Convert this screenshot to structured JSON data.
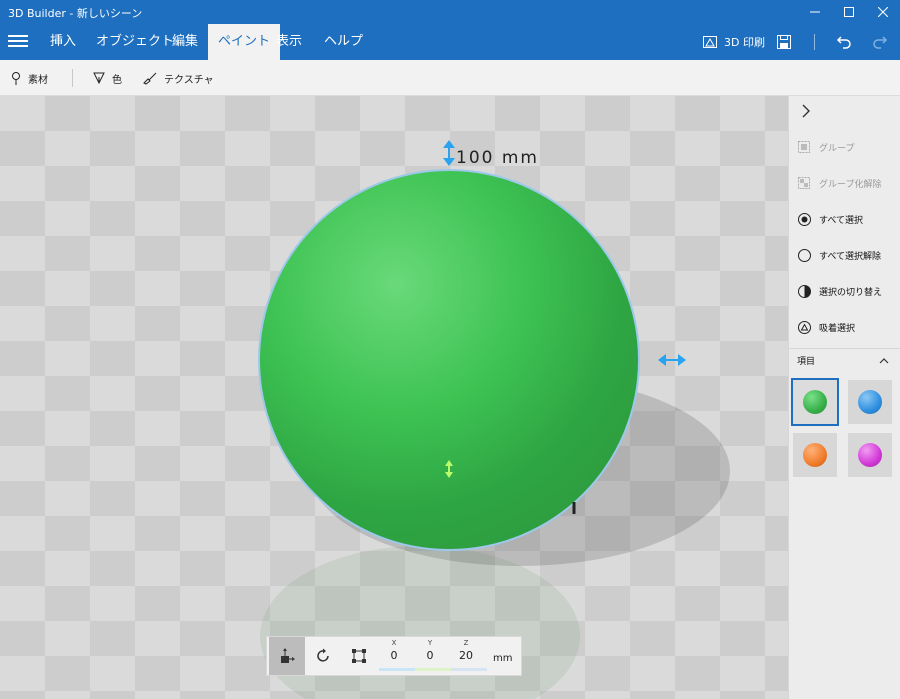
{
  "window": {
    "title": "3D Builder - 新しいシーン",
    "minimize": "—",
    "maximize": "□",
    "close": "✕"
  },
  "menu": {
    "tabs": [
      {
        "label": "挿入"
      },
      {
        "label": "オブジェクト"
      },
      {
        "label": "編集"
      },
      {
        "label": "ペイント"
      },
      {
        "label": "表示"
      },
      {
        "label": "ヘルプ"
      }
    ],
    "active_tab": "ペイント",
    "print_label": "3D 印刷"
  },
  "toolbar": {
    "material_label": "素材",
    "color_label": "色",
    "texture_label": "テクスチャ"
  },
  "viewport": {
    "dimension_label": "100 mm",
    "object_color": "#3dbf55"
  },
  "panel": {
    "items": [
      {
        "label": "グループ",
        "enabled": false
      },
      {
        "label": "グループ化解除",
        "enabled": false
      },
      {
        "label": "すべて選択",
        "enabled": true
      },
      {
        "label": "すべて選択解除",
        "enabled": true
      },
      {
        "label": "選択の切り替え",
        "enabled": true
      },
      {
        "label": "吸着選択",
        "enabled": true
      }
    ],
    "section_title": "項目",
    "swatches": [
      {
        "name": "green",
        "color": "#38b04a",
        "selected": true
      },
      {
        "name": "blue",
        "color": "#2f8fe0",
        "selected": false
      },
      {
        "name": "orange",
        "color": "#f07c2a",
        "selected": false
      },
      {
        "name": "magenta",
        "color": "#d23ad6",
        "selected": false
      }
    ]
  },
  "transform": {
    "x_label": "X",
    "y_label": "Y",
    "z_label": "Z",
    "x": "0",
    "y": "0",
    "z": "20",
    "unit": "mm"
  },
  "colors": {
    "accent": "#1e6fbf",
    "handle": "#29a3f0"
  }
}
